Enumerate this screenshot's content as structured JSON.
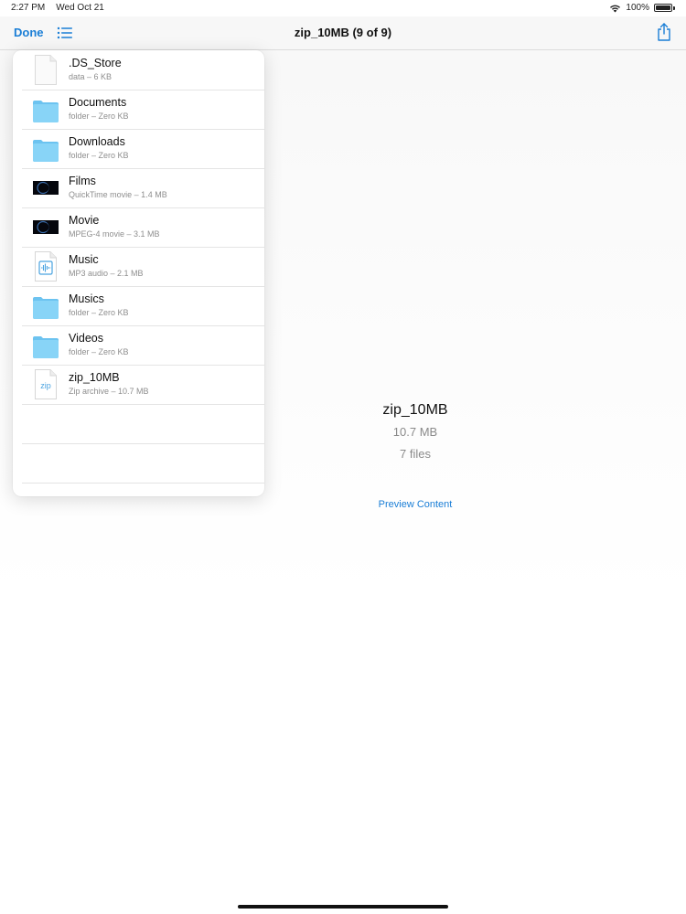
{
  "status_bar": {
    "time": "2:27 PM",
    "date": "Wed Oct 21",
    "battery": "100%"
  },
  "nav": {
    "done_label": "Done",
    "title": "zip_10MB (9 of 9)",
    "list_icon": "list-icon",
    "share_icon": "share-icon"
  },
  "files": [
    {
      "name": ".DS_Store",
      "meta": "data – 6 KB",
      "icon": "document-icon"
    },
    {
      "name": "Documents",
      "meta": "folder – Zero KB",
      "icon": "folder-icon"
    },
    {
      "name": "Downloads",
      "meta": "folder – Zero KB",
      "icon": "folder-icon"
    },
    {
      "name": "Films",
      "meta": "QuickTime movie – 1.4 MB",
      "icon": "movie-thumbnail-icon"
    },
    {
      "name": "Movie",
      "meta": "MPEG-4 movie – 3.1 MB",
      "icon": "movie-thumbnail-icon"
    },
    {
      "name": "Music",
      "meta": "MP3 audio – 2.1 MB",
      "icon": "audio-file-icon"
    },
    {
      "name": "Musics",
      "meta": "folder – Zero KB",
      "icon": "folder-icon"
    },
    {
      "name": "Videos",
      "meta": "folder – Zero KB",
      "icon": "folder-icon"
    },
    {
      "name": "zip_10MB",
      "meta": "Zip archive – 10.7 MB",
      "icon": "zip-file-icon",
      "icon_text": "zip"
    }
  ],
  "preview": {
    "title": "zip_10MB",
    "size": "10.7 MB",
    "count": "7 files",
    "link_label": "Preview Content"
  },
  "colors": {
    "accent": "#1a7ed6",
    "folder": "#7fcff5",
    "secondary_text": "#8e8e8e"
  }
}
